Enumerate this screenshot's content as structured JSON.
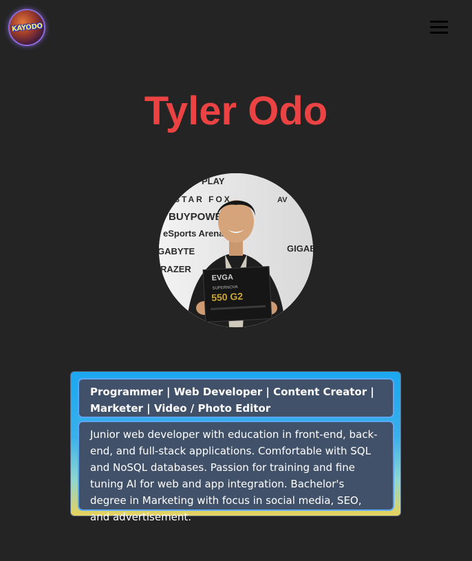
{
  "header": {
    "logo_text": "KAYODO",
    "menu_icon": "hamburger-menu-icon"
  },
  "hero": {
    "name": "Tyler Odo",
    "photo_sponsor_logos": [
      "PLAY",
      "STAR FOX",
      "BUYPOWER",
      "eSports Arena",
      "GABYTE",
      "GIGABYTE",
      "RAZER",
      "AV"
    ],
    "photo_box_text": [
      "EVGA",
      "SUPERNOVA",
      "550 G2"
    ]
  },
  "info": {
    "roles": "Programmer | Web Developer | Content Creator | Marketer | Video / Photo Editor",
    "bio": "Junior web developer with education in front-end, back-end, and full-stack applications. Comfortable with SQL and NoSQL databases. Passion for training and fine tuning AI for web and app integration. Bachelor's degree in Marketing with focus in social media, SEO, and advertisement."
  },
  "colors": {
    "background": "#242424",
    "name": "#eb4343",
    "card_box": "#415169",
    "card_border": "#5ba7f5",
    "gradient_top": "#1ba7f0",
    "gradient_bottom": "#e8d25c"
  }
}
